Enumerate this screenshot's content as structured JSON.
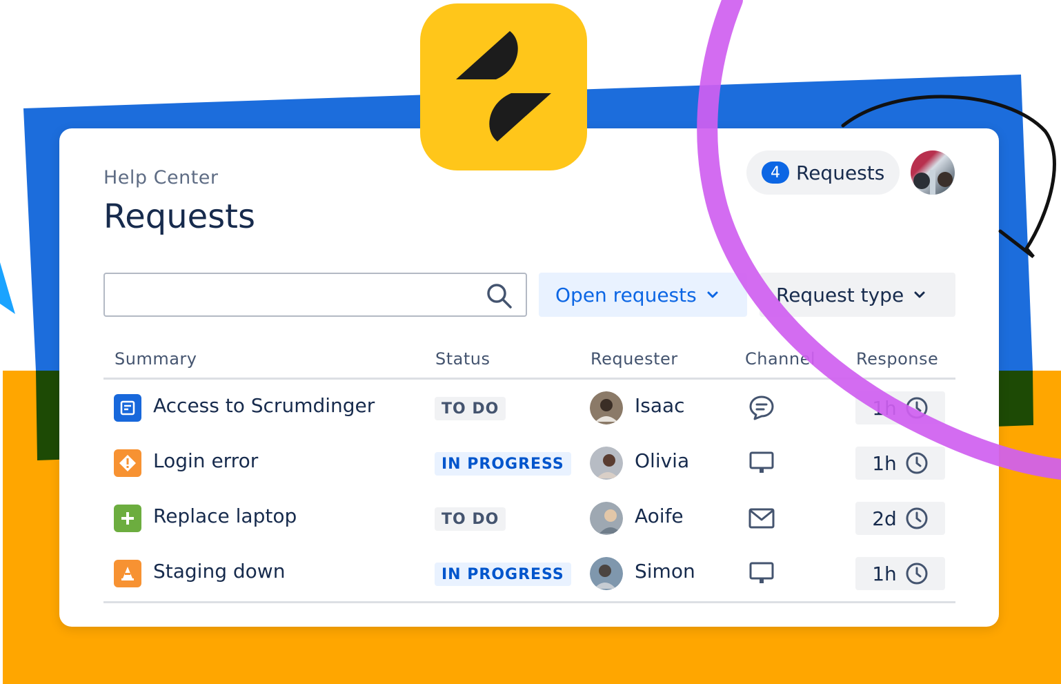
{
  "colors": {
    "blue_band": "#1c6ddc",
    "orange_band": "#ffa600",
    "green_strip": "#1d4a05",
    "logo_bg": "#ffc61a",
    "accent": "#0c66e4",
    "purple_stroke": "#cf5ff0"
  },
  "logo": {
    "icon": "jira-service-management-logo-icon"
  },
  "header": {
    "breadcrumb": "Help Center",
    "title": "Requests",
    "requests_count": "4",
    "requests_label": "Requests",
    "avatar_icon": "user-avatar"
  },
  "search": {
    "placeholder": "",
    "value": "",
    "icon": "search-icon"
  },
  "filters": {
    "open_requests": "Open requests",
    "request_type": "Request type"
  },
  "table": {
    "headers": {
      "summary": "Summary",
      "status": "Status",
      "requester": "Requester",
      "channel": "Channel",
      "response": "Response"
    },
    "rows": [
      {
        "summary": "Access to Scrumdinger",
        "type_icon": "service-request-icon",
        "type_color": "#1868db",
        "status": "TO DO",
        "requester": "Isaac",
        "channel": "chat-icon",
        "response": "1h"
      },
      {
        "summary": "Login error",
        "type_icon": "incident-icon",
        "type_color": "#f79232",
        "status": "IN PROGRESS",
        "requester": "Olivia",
        "channel": "monitor-icon",
        "response": "1h"
      },
      {
        "summary": "Replace laptop",
        "type_icon": "new-feature-icon",
        "type_color": "#6cad3f",
        "status": "TO DO",
        "requester": "Aoife",
        "channel": "email-icon",
        "response": "2d"
      },
      {
        "summary": "Staging down",
        "type_icon": "problem-icon",
        "type_color": "#f79232",
        "status": "IN PROGRESS",
        "requester": "Simon",
        "channel": "monitor-icon",
        "response": "1h"
      }
    ]
  }
}
